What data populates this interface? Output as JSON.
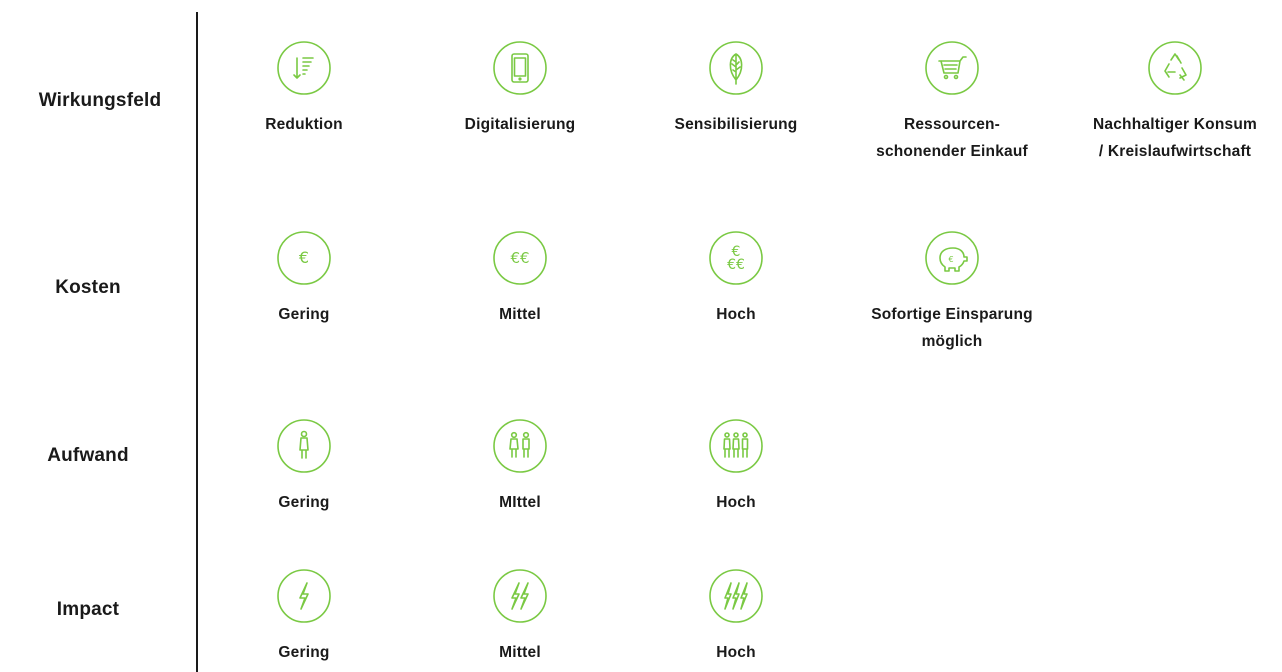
{
  "rows": [
    {
      "label": "Wirkungsfeld",
      "items": [
        {
          "icon": "sorted-list-icon",
          "label": "Reduktion"
        },
        {
          "icon": "smartphone-icon",
          "label": "Digitalisierung"
        },
        {
          "icon": "feather-icon",
          "label": "Sensibilisierung"
        },
        {
          "icon": "shopping-cart-icon",
          "label": "Ressourcen-\nschonender Einkauf"
        },
        {
          "icon": "recycle-icon",
          "label": "Nachhaltiger Konsum\n/ Kreislaufwirtschaft"
        }
      ]
    },
    {
      "label": "Kosten",
      "items": [
        {
          "icon": "single-euro-icon",
          "label": "Gering"
        },
        {
          "icon": "double-euro-icon",
          "label": "Mittel"
        },
        {
          "icon": "triple-euro-icon",
          "label": "Hoch"
        },
        {
          "icon": "piggy-bank-icon",
          "label": "Sofortige Einsparung\nmöglich"
        }
      ]
    },
    {
      "label": "Aufwand",
      "items": [
        {
          "icon": "one-person-icon",
          "label": "Gering"
        },
        {
          "icon": "two-persons-icon",
          "label": "MIttel"
        },
        {
          "icon": "three-persons-icon",
          "label": "Hoch"
        }
      ]
    },
    {
      "label": "Impact",
      "items": [
        {
          "icon": "one-lightning-icon",
          "label": "Gering"
        },
        {
          "icon": "two-lightning-icon",
          "label": "Mittel"
        },
        {
          "icon": "three-lightning-icon",
          "label": "Hoch"
        }
      ]
    }
  ],
  "colors": {
    "icon": "#7ac943",
    "text": "#1a1a1a"
  }
}
